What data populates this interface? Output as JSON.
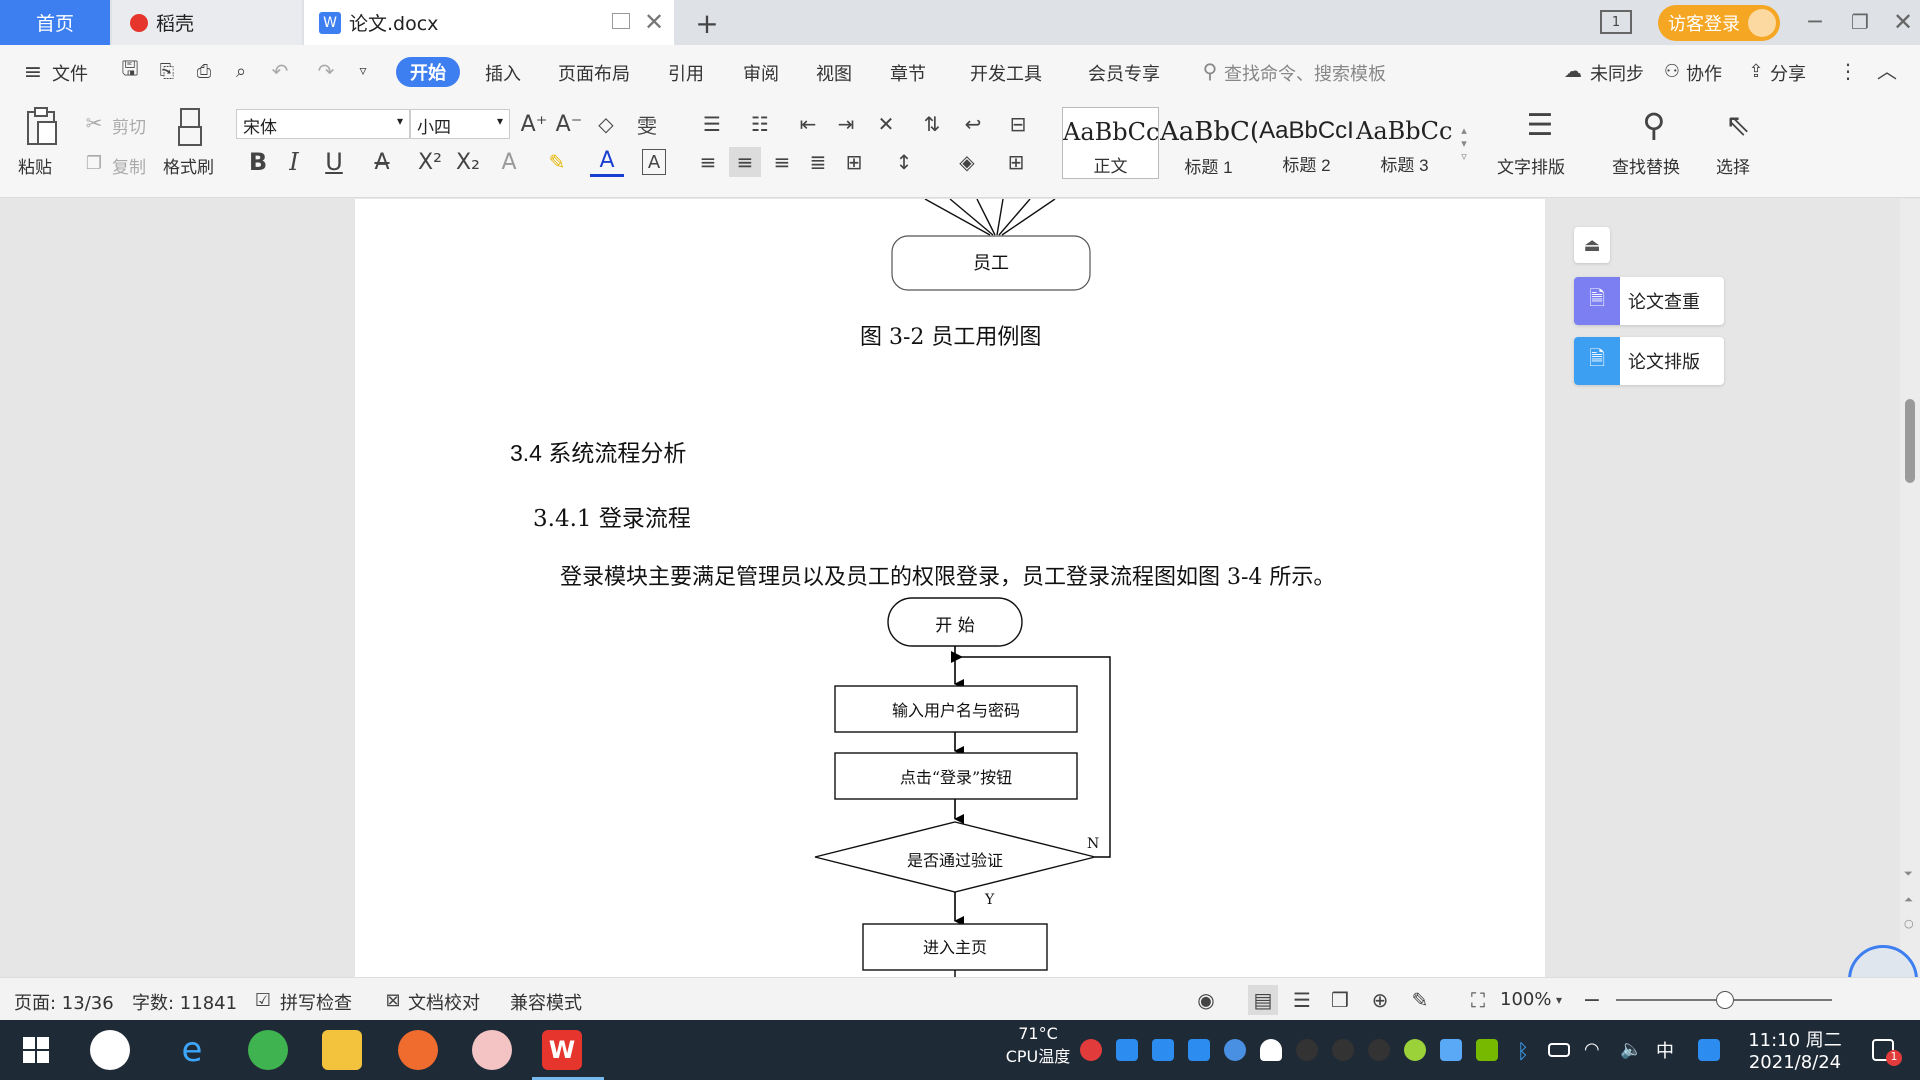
{
  "tabs": {
    "home": "首页",
    "daoke": "稻壳",
    "doc": "论文.docx",
    "login": "访客登录"
  },
  "menu": {
    "file": "文件",
    "items": [
      "开始",
      "插入",
      "页面布局",
      "引用",
      "审阅",
      "视图",
      "章节",
      "开发工具",
      "会员专享"
    ],
    "search_placeholder": "查找命令、搜索模板",
    "sync": "未同步",
    "collab": "协作",
    "share": "分享"
  },
  "ribbon": {
    "paste": "粘贴",
    "cut": "剪切",
    "copy": "复制",
    "format_painter": "格式刷",
    "font": "宋体",
    "size": "小四",
    "styles": [
      {
        "sample": "AaBbCcI",
        "name": "正文"
      },
      {
        "sample": "AaBbC(",
        "name": "标题 1"
      },
      {
        "sample": "AaBbCcI",
        "name": "标题 2"
      },
      {
        "sample": "AaBbCcI",
        "name": "标题 3"
      }
    ],
    "text_layout": "文字排版",
    "find_replace": "查找替换",
    "select": "选择"
  },
  "document": {
    "node_employee": "员工",
    "figure_caption": "图 3-2  员工用例图",
    "heading_34": "3.4 系统流程分析",
    "heading_341": "3.4.1 登录流程",
    "paragraph": "登录模块主要满足管理员以及员工的权限登录，员工登录流程图如图 3-4 所示。",
    "flow_start": "开  始",
    "flow_input": "输入用户名与密码",
    "flow_click": "点击“登录”按钮",
    "flow_verify": "是否通过验证",
    "flow_no": "N",
    "flow_yes": "Y",
    "flow_home": "进入主页"
  },
  "side_panel": {
    "check": "论文查重",
    "format": "论文排版"
  },
  "status": {
    "page": "页面: 13/36",
    "words": "字数: 11841",
    "spell": "拼写检查",
    "proof": "文档校对",
    "compat": "兼容模式",
    "zoom": "100%"
  },
  "taskbar": {
    "temp": "71°C",
    "temp_label": "CPU温度",
    "ime": "中",
    "time": "11:10 周二",
    "date": "2021/8/24",
    "notif_count": "1"
  },
  "colors": {
    "accent_blue": "#3d7ef0",
    "login_orange": "#f5a623"
  }
}
